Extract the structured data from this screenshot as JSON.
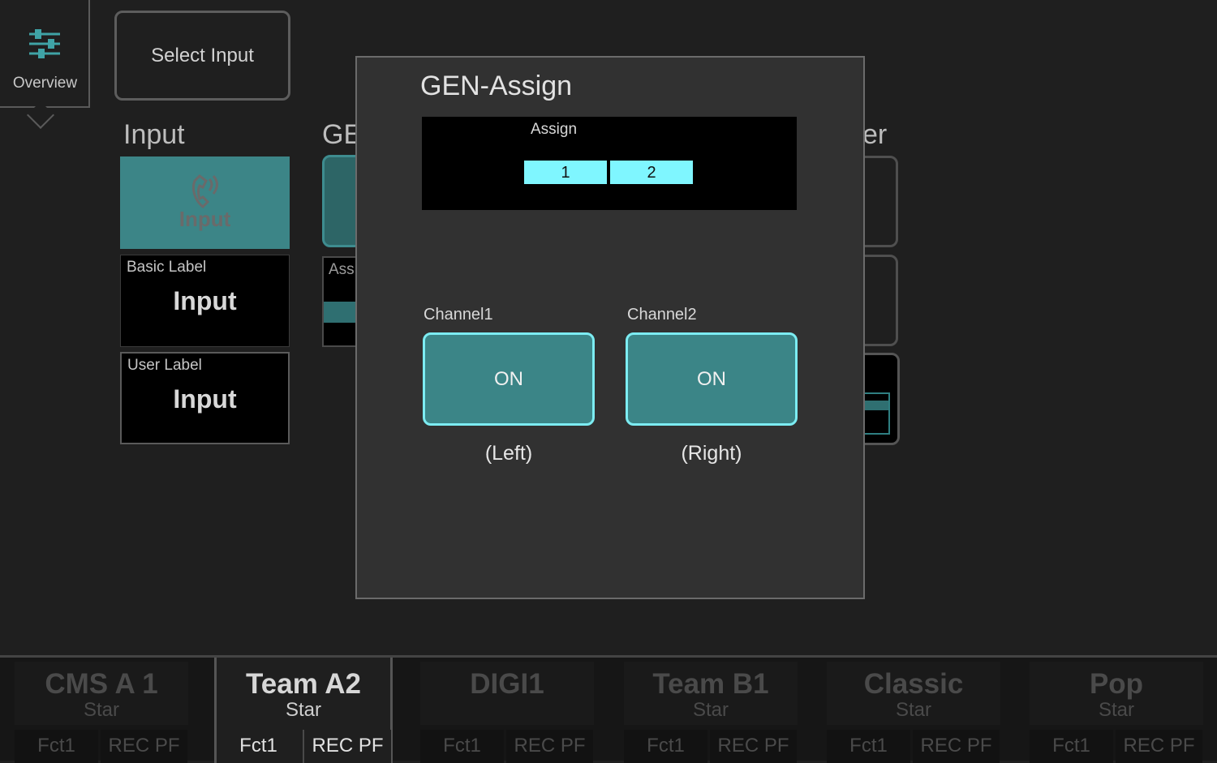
{
  "overview": {
    "label": "Overview",
    "icon": "sliders-icon"
  },
  "select_input": {
    "label": "Select Input"
  },
  "sections": {
    "input_title": "Input",
    "gen_title_partial": "GE",
    "right_title_partial": "er",
    "assign_partial": "Ass"
  },
  "input_tile": {
    "icon": "phone-signal-icon",
    "label": "Input"
  },
  "basic_label": {
    "caption": "Basic Label",
    "value": "Input"
  },
  "user_label": {
    "caption": "User Label",
    "value": "Input"
  },
  "modal": {
    "title": "GEN-Assign",
    "assign_caption": "Assign",
    "segments": [
      "1",
      "2"
    ],
    "channel1": {
      "label": "Channel1",
      "button": "ON",
      "side": "(Left)"
    },
    "channel2": {
      "label": "Channel2",
      "button": "ON",
      "side": "(Right)"
    }
  },
  "colors": {
    "accent": "#3b8587",
    "highlight": "#7ff6ff",
    "button_border": "#7cecf2"
  },
  "strips": [
    {
      "name": "CMS A 1",
      "sub": "Star",
      "fct": "Fct1",
      "rec": "REC PF",
      "active": false
    },
    {
      "name": "Team A2",
      "sub": "Star",
      "fct": "Fct1",
      "rec": "REC PF",
      "active": true
    },
    {
      "name": "DIGI1",
      "sub": "",
      "fct": "Fct1",
      "rec": "REC PF",
      "active": false
    },
    {
      "name": "Team B1",
      "sub": "Star",
      "fct": "Fct1",
      "rec": "REC PF",
      "active": false
    },
    {
      "name": "Classic",
      "sub": "Star",
      "fct": "Fct1",
      "rec": "REC PF",
      "active": false
    },
    {
      "name": "Pop",
      "sub": "Star",
      "fct": "Fct1",
      "rec": "REC PF",
      "active": false
    }
  ]
}
